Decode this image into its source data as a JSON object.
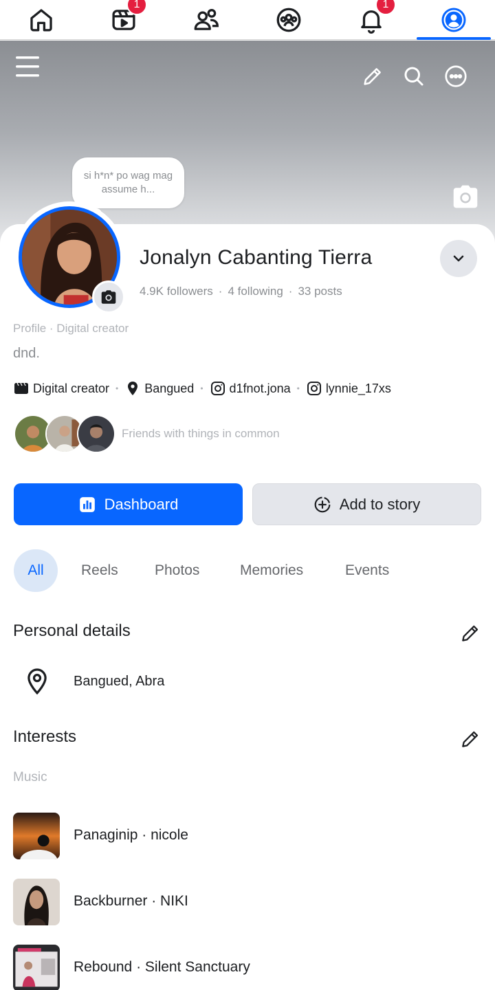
{
  "nav": {
    "items": [
      {
        "name": "home",
        "icon": "home-icon"
      },
      {
        "name": "video",
        "icon": "video-icon",
        "badge": "1"
      },
      {
        "name": "friends",
        "icon": "friends-icon"
      },
      {
        "name": "groups",
        "icon": "groups-icon"
      },
      {
        "name": "notifications",
        "icon": "bell-icon",
        "badge": "1"
      },
      {
        "name": "profile",
        "icon": "profile-icon",
        "active": true
      }
    ]
  },
  "note": {
    "text": "si h*n* po wag mag assume h..."
  },
  "profile": {
    "name": "Jonalyn Cabanting Tierra",
    "followers": "4.9K followers",
    "following": "4 following",
    "posts": "33 posts",
    "subtitle": "Profile · Digital creator",
    "bio": "dnd."
  },
  "info": {
    "category": "Digital creator",
    "location": "Bangued",
    "instagram_1": "d1fnot.jona",
    "instagram_2": "lynnie_17xs"
  },
  "friends": {
    "text": "Friends with things in common"
  },
  "actions": {
    "dashboard_label": "Dashboard",
    "add_story_label": "Add to story"
  },
  "tabs": [
    "All",
    "Reels",
    "Photos",
    "Memories",
    "Events"
  ],
  "personal_details": {
    "title": "Personal details",
    "location": "Bangued, Abra"
  },
  "interests": {
    "title": "Interests",
    "music_label": "Music",
    "songs": [
      {
        "title": "Panaginip · nicole"
      },
      {
        "title": "Backburner · NIKI"
      },
      {
        "title": "Rebound · Silent Sanctuary"
      }
    ]
  },
  "colors": {
    "accent": "#0866ff",
    "badge": "#e41e3f",
    "muted": "#8a8d91"
  }
}
